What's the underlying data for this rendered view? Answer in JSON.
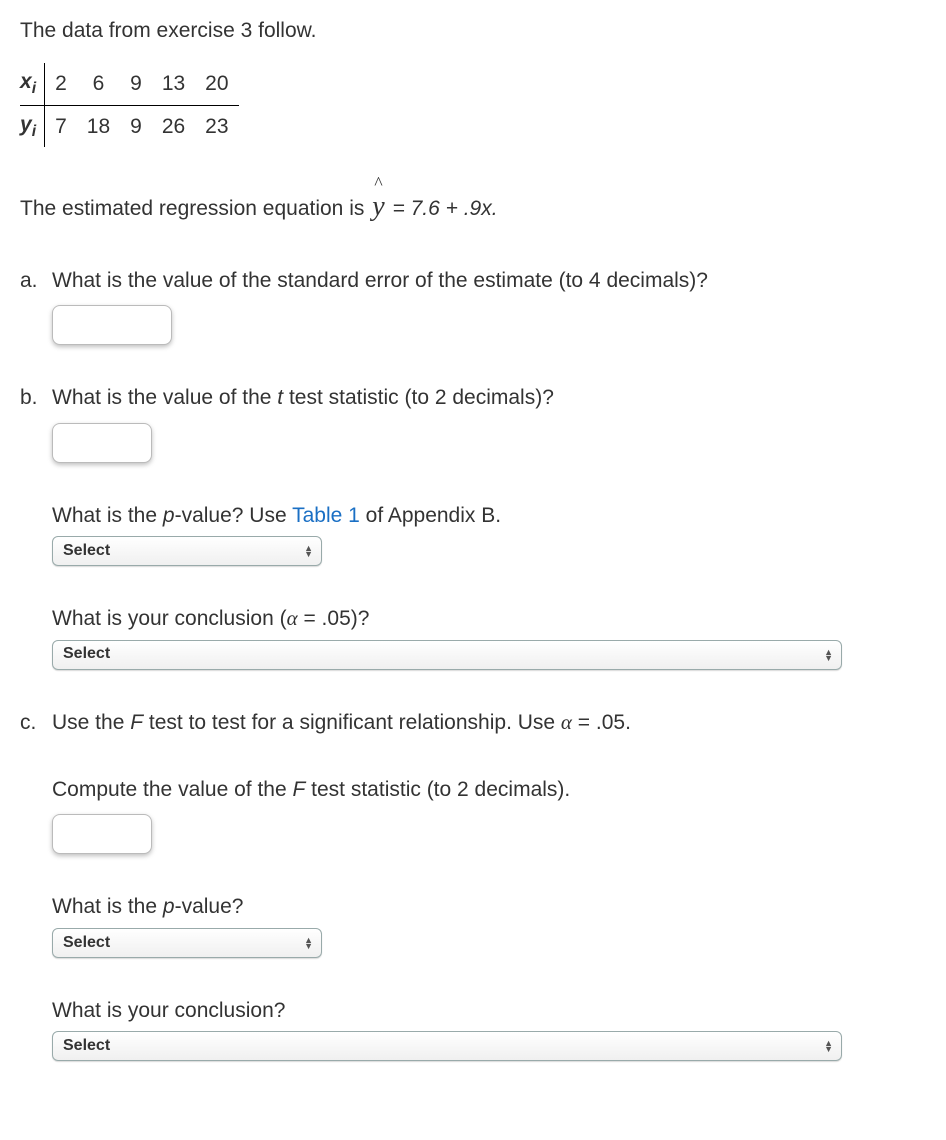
{
  "intro": "The data from exercise 3 follow.",
  "table": {
    "row1_label_base": "x",
    "row1_label_sub": "i",
    "row1": [
      "2",
      "6",
      "9",
      "13",
      "20"
    ],
    "row2_label_base": "y",
    "row2_label_sub": "i",
    "row2": [
      "7",
      "18",
      "9",
      "26",
      "23"
    ]
  },
  "equation": {
    "prefix": "The estimated regression equation is ",
    "yhat": "y",
    "suffix": " = 7.6 + .9x."
  },
  "qa": {
    "marker": "a.",
    "text": "What is the value of the standard error of the estimate (to 4 decimals)?"
  },
  "qb": {
    "marker": "b.",
    "text_before": "What is the value of the ",
    "ital": "t",
    "text_after": " test statistic (to 2 decimals)?"
  },
  "qb_pvalue": {
    "text_before": "What is the ",
    "ital": "p",
    "text_mid": "-value? Use ",
    "link": "Table 1",
    "text_after": " of Appendix B.",
    "select": "Select"
  },
  "qb_conclusion": {
    "text_before": "What is your conclusion (",
    "alpha": "α",
    "text_after": " = .05)?",
    "select": "Select"
  },
  "qc": {
    "marker": "c.",
    "text_before": "Use the ",
    "ital": "F",
    "text_mid": " test to test for a significant relationship. Use ",
    "alpha": "α",
    "text_after": " = .05."
  },
  "qc_compute": {
    "text_before": "Compute the value of the ",
    "ital": "F",
    "text_after": " test statistic (to 2 decimals)."
  },
  "qc_pvalue": {
    "text_before": "What is the ",
    "ital": "p",
    "text_after": "-value?",
    "select": "Select"
  },
  "qc_conclusion": {
    "text": "What is your conclusion?",
    "select": "Select"
  }
}
